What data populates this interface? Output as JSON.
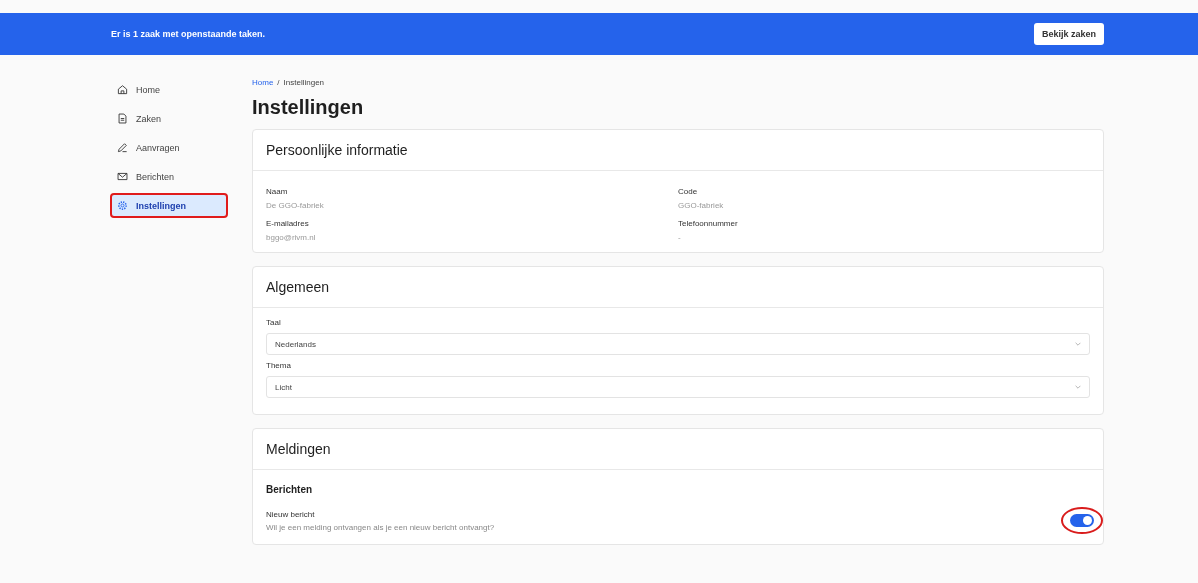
{
  "banner": {
    "message": "Er is 1 zaak met openstaande taken.",
    "button": "Bekijk zaken"
  },
  "sidebar": {
    "items": [
      {
        "label": "Home",
        "selected": false,
        "annotated": false
      },
      {
        "label": "Zaken",
        "selected": false,
        "annotated": false
      },
      {
        "label": "Aanvragen",
        "selected": false,
        "annotated": false
      },
      {
        "label": "Berichten",
        "selected": false,
        "annotated": false
      },
      {
        "label": "Instellingen",
        "selected": true,
        "annotated": true
      }
    ]
  },
  "breadcrumb": [
    {
      "label": "Home",
      "kind": "link"
    },
    {
      "label": "/",
      "kind": "text"
    },
    {
      "label": "Instellingen",
      "kind": "text"
    }
  ],
  "page_title": "Instellingen",
  "personal": {
    "title": "Persoonlijke informatie",
    "fields": [
      {
        "label": "Naam",
        "value": "De GGO-fabriek"
      },
      {
        "label": "Code",
        "value": "GGO-fabriek"
      },
      {
        "label": "E-mailadres",
        "value": "bggo@rivm.nl"
      },
      {
        "label": "Telefoonnummer",
        "value": "-"
      }
    ]
  },
  "general": {
    "title": "Algemeen",
    "selects": [
      {
        "label": "Taal",
        "value": "Nederlands"
      },
      {
        "label": "Thema",
        "value": "Licht"
      }
    ]
  },
  "notifications": {
    "title": "Meldingen",
    "section": "Berichten",
    "setting": {
      "label": "Nieuw bericht",
      "description": "Wil je een melding ontvangen als je een nieuw bericht ontvangt?",
      "on": true,
      "annotated": true
    }
  }
}
